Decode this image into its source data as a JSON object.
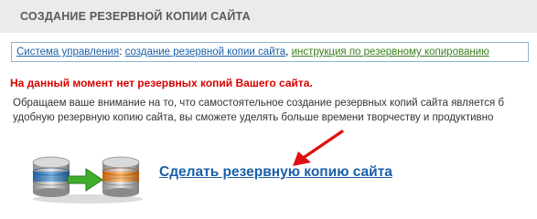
{
  "header": {
    "title": "СОЗДАНИЕ РЕЗЕРВНОЙ КОПИИ САЙТА"
  },
  "breadcrumb": {
    "root": "Система управления",
    "separator1": ":",
    "current": "создание резервной копии сайта",
    "separator2": ",",
    "help": "инструкция по резервному копированию"
  },
  "alert": "На данный момент нет резервных копий Вашего сайта.",
  "paragraph": {
    "line1": "Обращаем ваше внимание на то, что самостоятельное создание резервных копий сайта является б",
    "line2": "удобную резервную копию сайта, вы сможете уделять больше времени творчеству и продуктивно"
  },
  "action": {
    "label": "Сделать резервную копию сайта"
  },
  "colors": {
    "link": "#1a5fa8",
    "alert": "#d80000",
    "help_link": "#3a7f1a",
    "arrow": "#e01010",
    "header_bg": "#ebebeb"
  },
  "icons": {
    "backup": "database-copy-icon",
    "pointer": "red-arrow-icon"
  }
}
